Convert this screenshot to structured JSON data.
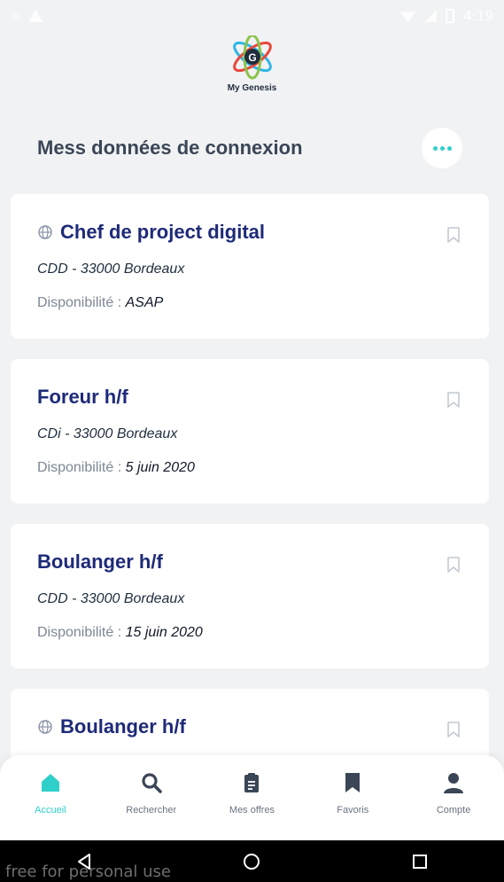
{
  "status_bar": {
    "time": "4:19"
  },
  "brand": {
    "name": "My Genesis"
  },
  "section": {
    "title": "Mess données de connexion"
  },
  "cards": [
    {
      "title": "Chef de project digital",
      "contract": "CDD - 33000 Bordeaux",
      "availability_label": "Disponibilité :",
      "availability_value": "ASAP",
      "globe": true
    },
    {
      "title": "Foreur h/f",
      "contract": "CDi - 33000 Bordeaux",
      "availability_label": "Disponibilité :",
      "availability_value": "5 juin 2020",
      "globe": false
    },
    {
      "title": "Boulanger h/f",
      "contract": "CDD - 33000 Bordeaux",
      "availability_label": "Disponibilité :",
      "availability_value": "15 juin 2020",
      "globe": false
    },
    {
      "title": "Boulanger h/f",
      "globe": true
    }
  ],
  "tabs": [
    {
      "label": "Accueil",
      "icon": "home-icon",
      "active": true
    },
    {
      "label": "Rechercher",
      "icon": "search-icon",
      "active": false
    },
    {
      "label": "Mes offres",
      "icon": "clipboard-icon",
      "active": false
    },
    {
      "label": "Favoris",
      "icon": "bookmark-icon",
      "active": false
    },
    {
      "label": "Compte",
      "icon": "user-icon",
      "active": false
    }
  ],
  "watermark": "free for personal use",
  "colors": {
    "accent": "#2fd0c9",
    "title": "#1e2a78",
    "background": "#f1f2f4"
  }
}
